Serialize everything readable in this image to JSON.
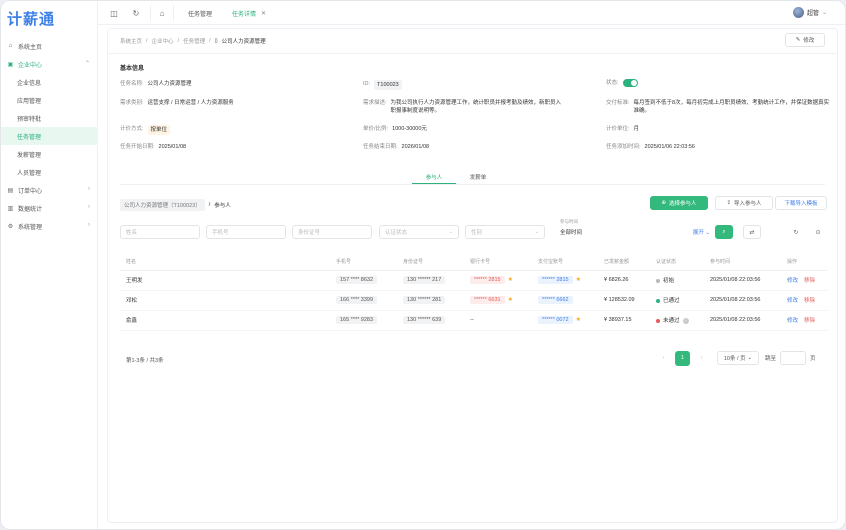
{
  "app": {
    "logo": "计薪通"
  },
  "sidebar": {
    "items": [
      {
        "label": "系统主页",
        "icon": "home-icon"
      },
      {
        "label": "企业中心",
        "icon": "building-icon",
        "open": true
      },
      {
        "label": "订单中心",
        "icon": "order-icon"
      },
      {
        "label": "数据统计",
        "icon": "chart-icon"
      },
      {
        "label": "系统管理",
        "icon": "gear-icon"
      }
    ],
    "sub": [
      "企业信息",
      "应用管理",
      "预审特批",
      "任务管理",
      "发薪管理",
      "人员管理"
    ]
  },
  "topbar": {
    "tabs": [
      "任务管理",
      "任务详情"
    ],
    "user": "超管"
  },
  "breadcrumb": [
    "系统主页",
    "企业中心",
    "任务管理",
    "公司人力资源管理"
  ],
  "edit_label": "修改",
  "section_title": "基本信息",
  "info": {
    "name_k": "任务名称:",
    "name_v": "公司人力资源管理",
    "id_k": "ID:",
    "id_v": "T100023",
    "status_k": "状态:",
    "cat_k": "需求类别:",
    "cat_v": "运营支撑 / 日常运营 / 人力资源服务",
    "desc_k": "需求描述:",
    "desc_v": "为我公司执行人力资源管理工作，统计职员并报考勤及绩效，新职员入职报事制度说明等。",
    "acc_k": "交付标准:",
    "acc_v": "每月签到不低于8次，每月初完成上月职员绩效、考勤统计工作，并保证数据真实准确。",
    "pay_k": "计价方式:",
    "pay_v": "按单位",
    "price_k": "单价/比例:",
    "price_v": "1000-30000元",
    "unit_k": "计价单位:",
    "unit_v": "月",
    "start_k": "任务开始日期:",
    "start_v": "2025/01/08",
    "end_k": "任务结束日期:",
    "end_v": "2026/01/08",
    "created_k": "任务添加时间:",
    "created_v": "2025/01/06 22:03:56"
  },
  "subtabs": [
    "参与人",
    "发薪单"
  ],
  "pcrumb": {
    "parent": "公司人力资源管理（T100023）",
    "current": "参与人"
  },
  "actions": {
    "select": "选择参与人",
    "import": "导入参与人",
    "template": "下载导入模板"
  },
  "filters": {
    "name": "姓名",
    "phone": "手机号",
    "idcard": "身份证号",
    "auth": "认证状态",
    "gender": "性别",
    "time_label": "参与时间",
    "time_value": "全部时间",
    "expand": "展开"
  },
  "table": {
    "headers": [
      "姓名",
      "手机号",
      "身份证号",
      "银行卡号",
      "支付宝账号",
      "已发薪金额",
      "认证状态",
      "参与时间",
      "操作"
    ],
    "rows": [
      {
        "name": "王明发",
        "phone": "157 **** 8632",
        "idcard": "130 ****** 217",
        "bank": "****** 2815",
        "bank_style": "red",
        "bank_star": true,
        "alipay": "****** 2815",
        "alipay_star": true,
        "amount": "¥ 6826.26",
        "auth": "初始",
        "auth_color": "#b8b8b8",
        "auth_help": false,
        "time": "2025/01/08 22:03:56"
      },
      {
        "name": "邓松",
        "phone": "166 **** 3399",
        "idcard": "130 ****** 281",
        "bank": "****** 6631",
        "bank_style": "red",
        "bank_star": true,
        "alipay": "****** 6662",
        "alipay_star": false,
        "amount": "¥ 128532.09",
        "auth": "已通过",
        "auth_color": "#2bb27d",
        "auth_help": false,
        "time": "2025/01/08 22:03:56"
      },
      {
        "name": "俞鑫",
        "phone": "165 **** 9283",
        "idcard": "130 ****** 639",
        "bank": "--",
        "bank_style": "none",
        "bank_star": false,
        "alipay": "****** 0072",
        "alipay_star": true,
        "amount": "¥ 38937.15",
        "auth": "未通过",
        "auth_color": "#e65a5a",
        "auth_help": true,
        "time": "2025/01/08 22:03:56"
      }
    ],
    "op_edit": "修改",
    "op_del": "移除"
  },
  "pagination": {
    "total": "第1-3条 / 共3条",
    "current": "1",
    "size": "10条 / 页",
    "jump": "跳至",
    "page": "页"
  },
  "colors": {
    "accent": "#2bb27d",
    "link": "#3d7fe8",
    "danger": "#e65a5a",
    "star": "#f5a623"
  }
}
